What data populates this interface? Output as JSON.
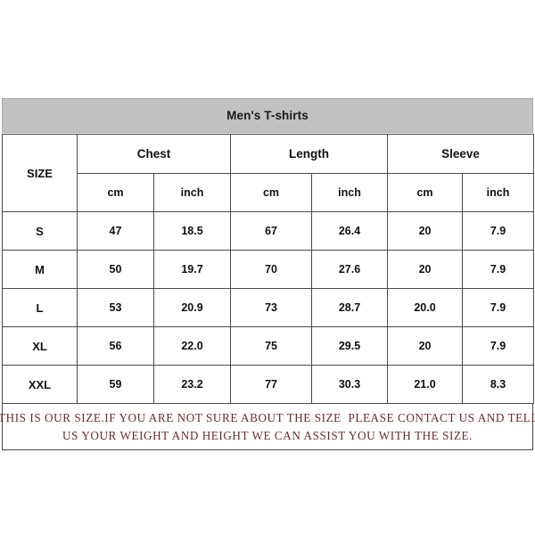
{
  "title": {
    "text": "Men's T-shirts"
  },
  "table": {
    "size_header": "SIZE",
    "groups": [
      {
        "label": "Chest"
      },
      {
        "label": "Length"
      },
      {
        "label": "Sleeve"
      }
    ],
    "units": [
      "cm",
      "inch",
      "cm",
      "inch",
      "cm",
      "inch"
    ],
    "rows": [
      {
        "size": "S",
        "chest_cm": "47",
        "chest_inch": "18.5",
        "length_cm": "67",
        "length_inch": "26.4",
        "sleeve_cm": "20",
        "sleeve_inch": "7.9"
      },
      {
        "size": "M",
        "chest_cm": "50",
        "chest_inch": "19.7",
        "length_cm": "70",
        "length_inch": "27.6",
        "sleeve_cm": "20",
        "sleeve_inch": "7.9"
      },
      {
        "size": "L",
        "chest_cm": "53",
        "chest_inch": "20.9",
        "length_cm": "73",
        "length_inch": "28.7",
        "sleeve_cm": "20.0",
        "sleeve_inch": "7.9"
      },
      {
        "size": "XL",
        "chest_cm": "56",
        "chest_inch": "22.0",
        "length_cm": "75",
        "length_inch": "29.5",
        "sleeve_cm": "20",
        "sleeve_inch": "7.9"
      },
      {
        "size": "XXL",
        "chest_cm": "59",
        "chest_inch": "23.2",
        "length_cm": "77",
        "length_inch": "30.3",
        "sleeve_cm": "21.0",
        "sleeve_inch": "8.3"
      }
    ]
  },
  "footer": {
    "line1": "THIS IS OUR SIZE.IF YOU ARE NOT SURE ABOUT THE SIZE  PLEASE CONTACT US AND TELL",
    "line2": "US YOUR WEIGHT AND HEIGHT WE CAN ASSIST YOU WITH THE SIZE."
  },
  "colors": {
    "title_band": "#c2c2c2",
    "border": "#4a4a4a",
    "footer_text": "#6e2b2b",
    "page_background": "#ffffff"
  }
}
